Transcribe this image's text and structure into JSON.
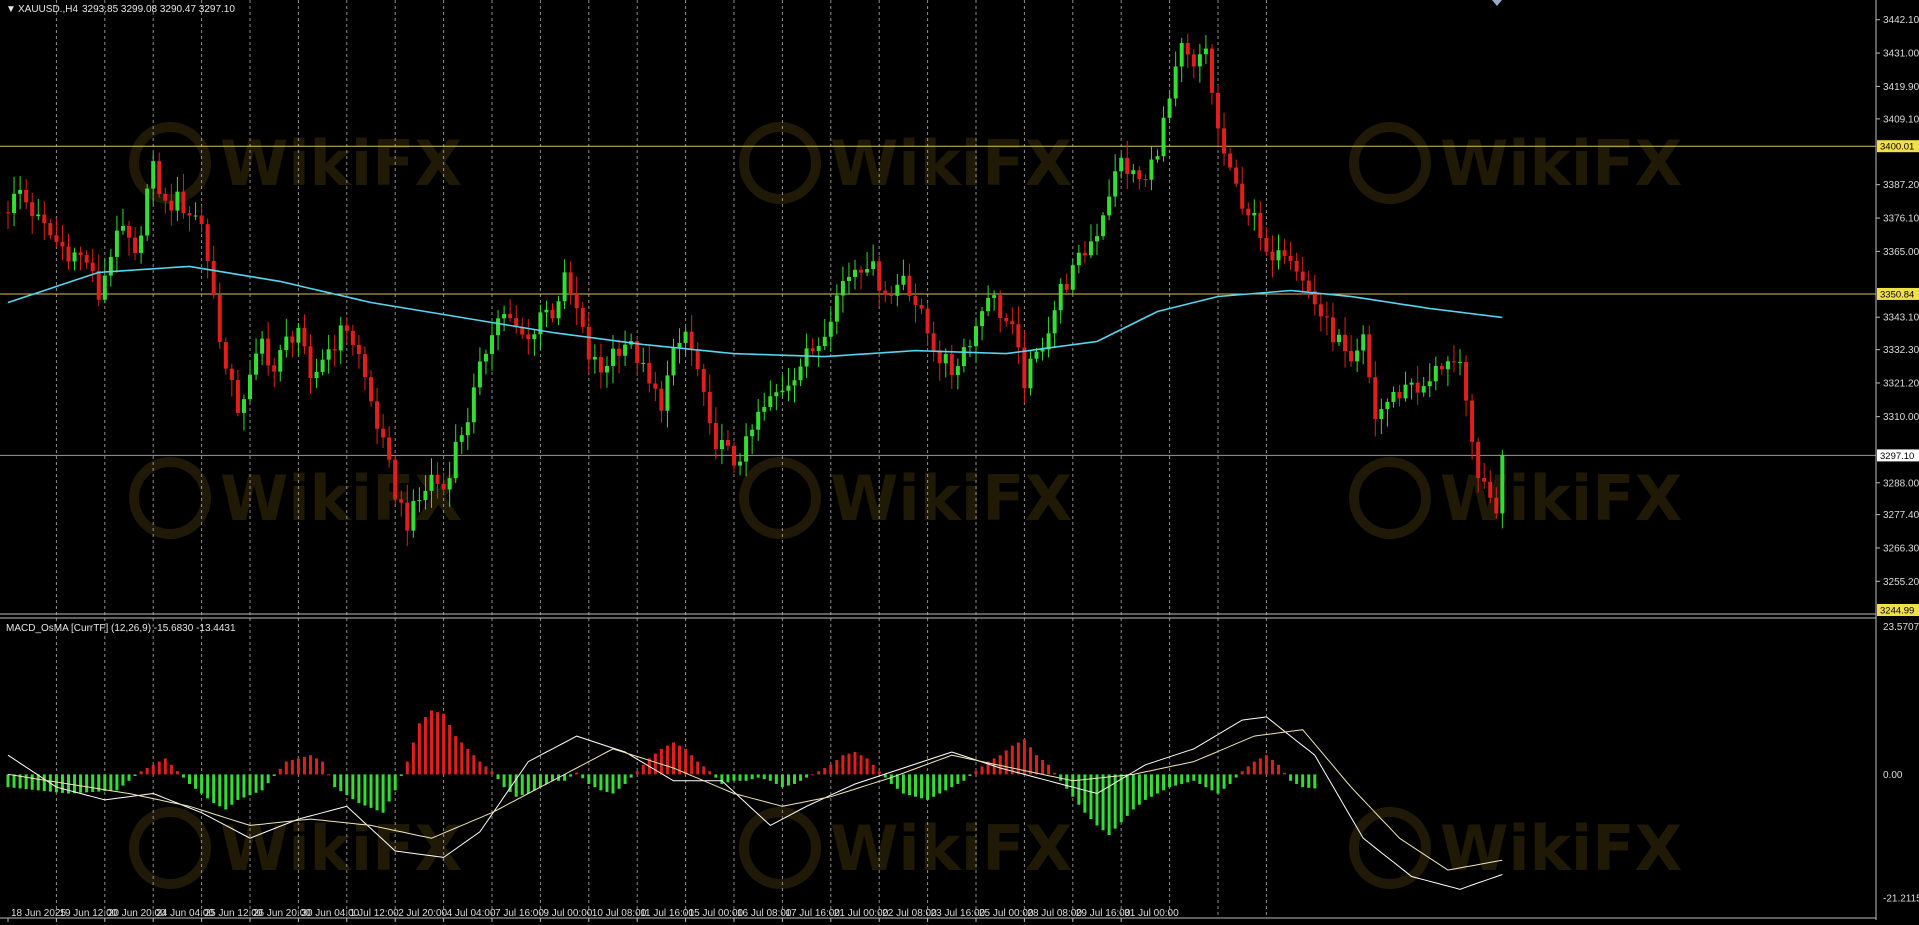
{
  "symbol_header": {
    "title": "XAUUSD.,H4",
    "ohlc": "3293.85 3299.08 3290.47 3297.10"
  },
  "watermark": "WikiFX",
  "colors": {
    "background": "#000000",
    "bull": "#33dd33",
    "bear": "#e01e1e",
    "moving_average": "#55d6f0",
    "hline": "#d8c060",
    "grid": "#bdbdbd",
    "macd_bull": "#33dd33",
    "macd_bear": "#e01e1e",
    "macd_line": "#ffffff",
    "signal_line": "#f0e6b4"
  },
  "chart_data": [
    {
      "type": "candlestick",
      "title": "XAUUSD.,H4",
      "ylim": [
        3244.99,
        3447.0
      ],
      "y_ticks": [
        "3442.10",
        "3431.00",
        "3419.90",
        "3409.10",
        "3387.20",
        "3376.10",
        "3365.00",
        "3343.10",
        "3332.30",
        "3321.20",
        "3310.00",
        "3288.00",
        "3277.40",
        "3266.30",
        "3255.20"
      ],
      "price_tags": [
        {
          "label": "3400.01",
          "value": 3400.01,
          "style": "hline"
        },
        {
          "label": "3350.84",
          "value": 3350.84,
          "style": "hline"
        },
        {
          "label": "3297.10",
          "value": 3297.1,
          "style": "current"
        },
        {
          "label": "3244.99",
          "value": 3244.99,
          "style": "bottom"
        }
      ],
      "hlines": [
        3400.01,
        3350.84
      ],
      "current_price": 3297.1,
      "x_labels": [
        "18 Jun 2025",
        "19 Jun 12:00",
        "20 Jun 20:00",
        "24 Jun 04:00",
        "25 Jun 12:00",
        "26 Jun 20:00",
        "30 Jun 04:00",
        "1 Jul 12:00",
        "2 Jul 20:00",
        "4 Jul 04:00",
        "7 Jul 16:00",
        "9 Jul 00:00",
        "10 Jul 08:00",
        "11 Jul 16:00",
        "15 Jul 00:00",
        "16 Jul 08:00",
        "17 Jul 16:00",
        "21 Jul 00:00",
        "22 Jul 08:00",
        "23 Jul 16:00",
        "25 Jul 00:00",
        "28 Jul 08:00",
        "29 Jul 16:00",
        "31 Jul 00:00"
      ],
      "bars_per_label": 8,
      "close_path": [
        [
          0,
          3380
        ],
        [
          2,
          3385
        ],
        [
          5,
          3375
        ],
        [
          8,
          3368
        ],
        [
          10,
          3365
        ],
        [
          13,
          3362
        ],
        [
          15,
          3350
        ],
        [
          17,
          3365
        ],
        [
          19,
          3372
        ],
        [
          21,
          3362
        ],
        [
          23,
          3385
        ],
        [
          24,
          3392
        ],
        [
          26,
          3380
        ],
        [
          28,
          3382
        ],
        [
          30,
          3378
        ],
        [
          32,
          3375
        ],
        [
          34,
          3350
        ],
        [
          36,
          3325
        ],
        [
          38,
          3313
        ],
        [
          40,
          3322
        ],
        [
          42,
          3335
        ],
        [
          44,
          3325
        ],
        [
          46,
          3335
        ],
        [
          48,
          3340
        ],
        [
          50,
          3320
        ],
        [
          52,
          3330
        ],
        [
          54,
          3335
        ],
        [
          56,
          3340
        ],
        [
          58,
          3330
        ],
        [
          60,
          3315
        ],
        [
          62,
          3300
        ],
        [
          64,
          3285
        ],
        [
          66,
          3275
        ],
        [
          68,
          3282
        ],
        [
          70,
          3290
        ],
        [
          72,
          3286
        ],
        [
          74,
          3300
        ],
        [
          76,
          3310
        ],
        [
          78,
          3325
        ],
        [
          80,
          3340
        ],
        [
          82,
          3345
        ],
        [
          84,
          3338
        ],
        [
          86,
          3335
        ],
        [
          88,
          3345
        ],
        [
          90,
          3345
        ],
        [
          92,
          3355
        ],
        [
          94,
          3345
        ],
        [
          96,
          3330
        ],
        [
          98,
          3325
        ],
        [
          100,
          3332
        ],
        [
          102,
          3335
        ],
        [
          104,
          3330
        ],
        [
          106,
          3320
        ],
        [
          108,
          3315
        ],
        [
          110,
          3330
        ],
        [
          112,
          3338
        ],
        [
          114,
          3325
        ],
        [
          116,
          3305
        ],
        [
          118,
          3300
        ],
        [
          120,
          3295
        ],
        [
          122,
          3300
        ],
        [
          124,
          3310
        ],
        [
          126,
          3315
        ],
        [
          128,
          3320
        ],
        [
          130,
          3325
        ],
        [
          132,
          3330
        ],
        [
          134,
          3335
        ],
        [
          136,
          3345
        ],
        [
          138,
          3355
        ],
        [
          140,
          3360
        ],
        [
          142,
          3362
        ],
        [
          144,
          3355
        ],
        [
          146,
          3350
        ],
        [
          148,
          3358
        ],
        [
          150,
          3348
        ],
        [
          152,
          3338
        ],
        [
          154,
          3330
        ],
        [
          156,
          3325
        ],
        [
          158,
          3333
        ],
        [
          160,
          3340
        ],
        [
          162,
          3352
        ],
        [
          164,
          3345
        ],
        [
          166,
          3338
        ],
        [
          168,
          3322
        ],
        [
          170,
          3330
        ],
        [
          172,
          3340
        ],
        [
          174,
          3352
        ],
        [
          176,
          3358
        ],
        [
          178,
          3365
        ],
        [
          180,
          3372
        ],
        [
          182,
          3385
        ],
        [
          184,
          3395
        ],
        [
          186,
          3390
        ],
        [
          188,
          3388
        ],
        [
          190,
          3400
        ],
        [
          192,
          3415
        ],
        [
          194,
          3432
        ],
        [
          196,
          3425
        ],
        [
          198,
          3432
        ],
        [
          200,
          3405
        ],
        [
          202,
          3390
        ],
        [
          204,
          3382
        ],
        [
          206,
          3375
        ],
        [
          208,
          3362
        ],
        [
          210,
          3368
        ],
        [
          212,
          3365
        ],
        [
          214,
          3355
        ],
        [
          216,
          3348
        ],
        [
          218,
          3340
        ],
        [
          220,
          3335
        ],
        [
          222,
          3325
        ],
        [
          224,
          3335
        ],
        [
          226,
          3310
        ],
        [
          228,
          3315
        ],
        [
          230,
          3318
        ],
        [
          232,
          3322
        ],
        [
          234,
          3318
        ],
        [
          236,
          3325
        ],
        [
          238,
          3330
        ],
        [
          240,
          3325
        ],
        [
          242,
          3300
        ],
        [
          244,
          3285
        ],
        [
          246,
          3280
        ],
        [
          247,
          3297.1
        ]
      ],
      "ma_path": [
        [
          0,
          3348
        ],
        [
          15,
          3358
        ],
        [
          30,
          3360
        ],
        [
          45,
          3355
        ],
        [
          60,
          3348
        ],
        [
          75,
          3343
        ],
        [
          90,
          3338
        ],
        [
          105,
          3334
        ],
        [
          120,
          3331
        ],
        [
          135,
          3330
        ],
        [
          150,
          3332
        ],
        [
          165,
          3331
        ],
        [
          180,
          3335
        ],
        [
          190,
          3345
        ],
        [
          200,
          3350
        ],
        [
          212,
          3352
        ],
        [
          222,
          3350
        ],
        [
          235,
          3346
        ],
        [
          247,
          3343
        ]
      ]
    },
    {
      "type": "bar",
      "title": "MACD_OsMA [CurrTF] (12,26,9) -15.6830 -13.4431",
      "ylim": [
        -22.5,
        24.5
      ],
      "y_ticks": [
        "0.00",
        "-21.2115"
      ],
      "top_tag": "23.5707",
      "histogram_path": [
        [
          0,
          -2
        ],
        [
          10,
          -3
        ],
        [
          18,
          -2.5
        ],
        [
          22,
          0.5
        ],
        [
          26,
          2.5
        ],
        [
          30,
          -1.5
        ],
        [
          34,
          -4.5
        ],
        [
          36,
          -5.5
        ],
        [
          38,
          -4
        ],
        [
          42,
          -2.5
        ],
        [
          46,
          2
        ],
        [
          50,
          3
        ],
        [
          52,
          2
        ],
        [
          54,
          -2
        ],
        [
          58,
          -4.5
        ],
        [
          62,
          -6
        ],
        [
          64,
          -2.5
        ],
        [
          66,
          2
        ],
        [
          68,
          8
        ],
        [
          70,
          10
        ],
        [
          72,
          9.5
        ],
        [
          74,
          6
        ],
        [
          76,
          4
        ],
        [
          78,
          2
        ],
        [
          80,
          0.5
        ],
        [
          82,
          -2
        ],
        [
          84,
          -3.5
        ],
        [
          86,
          -3
        ],
        [
          88,
          -2
        ],
        [
          90,
          -1
        ],
        [
          92,
          -1
        ],
        [
          94,
          0.3
        ],
        [
          96,
          -1.5
        ],
        [
          98,
          -2.5
        ],
        [
          100,
          -3
        ],
        [
          102,
          -1.5
        ],
        [
          104,
          0.5
        ],
        [
          106,
          2.5
        ],
        [
          108,
          4
        ],
        [
          110,
          5
        ],
        [
          112,
          4
        ],
        [
          114,
          2
        ],
        [
          116,
          0.5
        ],
        [
          118,
          -1.5
        ],
        [
          120,
          -1
        ],
        [
          122,
          -1
        ],
        [
          124,
          -0.5
        ],
        [
          126,
          -1
        ],
        [
          128,
          -2
        ],
        [
          130,
          -1.5
        ],
        [
          132,
          -0.5
        ],
        [
          134,
          0.5
        ],
        [
          136,
          1.5
        ],
        [
          138,
          3
        ],
        [
          140,
          3.5
        ],
        [
          142,
          2.5
        ],
        [
          144,
          0.5
        ],
        [
          146,
          -1.5
        ],
        [
          148,
          -3
        ],
        [
          150,
          -3.5
        ],
        [
          152,
          -4
        ],
        [
          154,
          -3
        ],
        [
          156,
          -2
        ],
        [
          158,
          -1
        ],
        [
          160,
          0.5
        ],
        [
          162,
          2
        ],
        [
          164,
          3
        ],
        [
          166,
          4.5
        ],
        [
          168,
          5.5
        ],
        [
          170,
          3
        ],
        [
          172,
          1.5
        ],
        [
          174,
          -1
        ],
        [
          176,
          -3.5
        ],
        [
          178,
          -6
        ],
        [
          180,
          -8
        ],
        [
          182,
          -9.5
        ],
        [
          184,
          -7.5
        ],
        [
          186,
          -5.5
        ],
        [
          188,
          -4
        ],
        [
          190,
          -3
        ],
        [
          192,
          -2
        ],
        [
          194,
          -1.5
        ],
        [
          196,
          -1
        ],
        [
          198,
          -2
        ],
        [
          200,
          -3
        ],
        [
          202,
          -1.5
        ],
        [
          204,
          0.5
        ],
        [
          206,
          2
        ],
        [
          208,
          3
        ],
        [
          210,
          1.5
        ],
        [
          212,
          -1
        ],
        [
          214,
          -2
        ],
        [
          216,
          -2.2
        ]
      ],
      "macd_line": [
        [
          0,
          3
        ],
        [
          8,
          -2
        ],
        [
          16,
          -4
        ],
        [
          24,
          -3
        ],
        [
          32,
          -6
        ],
        [
          40,
          -10
        ],
        [
          48,
          -7
        ],
        [
          56,
          -5
        ],
        [
          64,
          -12
        ],
        [
          72,
          -13
        ],
        [
          78,
          -9
        ],
        [
          86,
          2
        ],
        [
          94,
          6
        ],
        [
          102,
          3.5
        ],
        [
          110,
          -1
        ],
        [
          118,
          -1
        ],
        [
          126,
          -8
        ],
        [
          132,
          -5
        ],
        [
          140,
          -1.5
        ],
        [
          148,
          1
        ],
        [
          156,
          3.5
        ],
        [
          164,
          1
        ],
        [
          172,
          -1
        ],
        [
          180,
          -3
        ],
        [
          188,
          1.5
        ],
        [
          196,
          4
        ],
        [
          204,
          8.5
        ],
        [
          208,
          9
        ],
        [
          216,
          3
        ],
        [
          224,
          -10
        ],
        [
          232,
          -16
        ],
        [
          240,
          -18
        ],
        [
          247,
          -15.68
        ]
      ],
      "signal_line": [
        [
          0,
          0
        ],
        [
          10,
          -1.5
        ],
        [
          20,
          -3
        ],
        [
          30,
          -5
        ],
        [
          40,
          -8
        ],
        [
          50,
          -7
        ],
        [
          60,
          -8
        ],
        [
          70,
          -10
        ],
        [
          80,
          -6
        ],
        [
          90,
          -1
        ],
        [
          100,
          4
        ],
        [
          110,
          1
        ],
        [
          120,
          -3
        ],
        [
          128,
          -5
        ],
        [
          136,
          -3.5
        ],
        [
          146,
          -0.5
        ],
        [
          156,
          3
        ],
        [
          166,
          1
        ],
        [
          176,
          -1
        ],
        [
          186,
          0
        ],
        [
          196,
          2
        ],
        [
          206,
          6
        ],
        [
          214,
          7
        ],
        [
          222,
          -2
        ],
        [
          230,
          -10
        ],
        [
          238,
          -15
        ],
        [
          247,
          -13.44
        ]
      ]
    }
  ]
}
